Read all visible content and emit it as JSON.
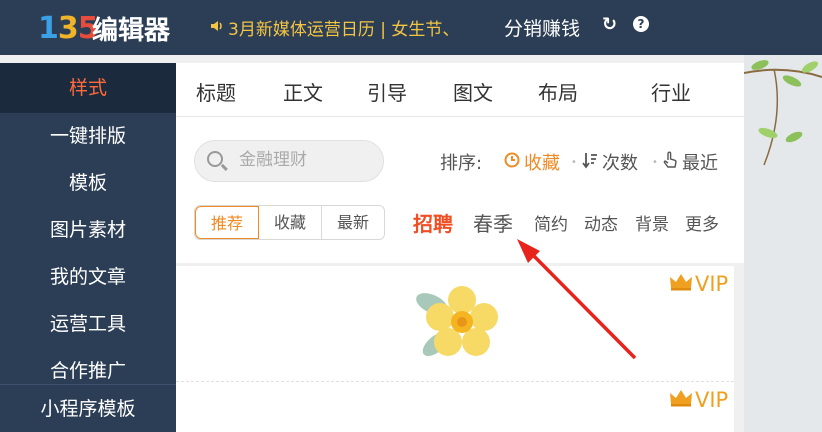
{
  "header": {
    "logo_digits": [
      "1",
      "3",
      "5"
    ],
    "logo_text": "编辑器",
    "notice": "3月新媒体运营日历 | 女生节、",
    "notice_icon": "speaker-icon",
    "earn_label": "分销赚钱",
    "refresh_icon": "↻",
    "help_icon": "?"
  },
  "sidebar": {
    "items": [
      {
        "label": "样式",
        "active": true
      },
      {
        "label": "一键排版"
      },
      {
        "label": "模板"
      },
      {
        "label": "图片素材"
      },
      {
        "label": "我的文章"
      },
      {
        "label": "运营工具"
      },
      {
        "label": "合作推广"
      }
    ],
    "bottom": "小程序模板"
  },
  "tabs": [
    "标题",
    "正文",
    "引导",
    "图文",
    "布局",
    "行业"
  ],
  "search": {
    "placeholder": "金融理财"
  },
  "sort": {
    "label": "排序:",
    "options": [
      {
        "label": "收藏",
        "icon": "clock-icon",
        "active": true
      },
      {
        "label": "次数",
        "icon": "sort-desc-icon"
      },
      {
        "label": "最近",
        "icon": "pointer-hand-icon"
      }
    ]
  },
  "filters": {
    "segments": [
      {
        "label": "推荐",
        "active": true
      },
      {
        "label": "收藏"
      },
      {
        "label": "最新"
      }
    ],
    "tags": [
      {
        "label": "招聘",
        "style": "hot"
      },
      {
        "label": "春季",
        "style": "big"
      },
      {
        "label": "简约"
      },
      {
        "label": "动态"
      },
      {
        "label": "背景"
      },
      {
        "label": "更多"
      }
    ]
  },
  "cards": [
    {
      "badge": "VIP"
    },
    {
      "badge": "VIP"
    }
  ],
  "colors": {
    "nav_bg": "#2c3e56",
    "accent": "#f08a24",
    "hot": "#f04e23",
    "notice": "#f4c542",
    "annotation_arrow": "#e8231c"
  }
}
